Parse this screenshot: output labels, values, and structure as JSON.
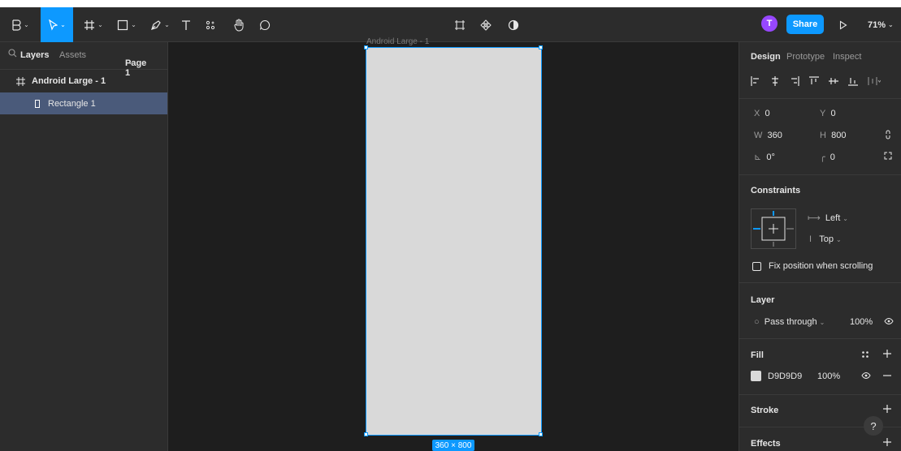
{
  "toolbar": {
    "zoom": "71%",
    "avatar_initial": "T",
    "share_label": "Share"
  },
  "left_panel": {
    "tab_layers": "Layers",
    "tab_assets": "Assets",
    "page": "Page 1",
    "layers": [
      {
        "name": "Android Large - 1",
        "type": "frame"
      },
      {
        "name": "Rectangle 1",
        "type": "rectangle",
        "selected": true
      }
    ]
  },
  "canvas": {
    "frame_label": "Android Large - 1",
    "size_badge": "360 × 800"
  },
  "right_panel": {
    "tabs": [
      "Design",
      "Prototype",
      "Inspect"
    ],
    "x_label": "X",
    "x": "0",
    "y_label": "Y",
    "y": "0",
    "w_label": "W",
    "w": "360",
    "h_label": "H",
    "h": "800",
    "rotation": "0°",
    "radius": "0",
    "constraints_title": "Constraints",
    "constraint_h": "Left",
    "constraint_v": "Top",
    "fix_position": "Fix position when scrolling",
    "layer_title": "Layer",
    "blend": "Pass through",
    "layer_opacity": "100%",
    "fill_title": "Fill",
    "fill_hex": "D9D9D9",
    "fill_color": "#d9d9d9",
    "fill_opacity": "100%",
    "stroke_title": "Stroke",
    "effects_title": "Effects"
  },
  "colors": {
    "accent": "#0d99ff",
    "avatar": "#9747ff",
    "selection_row": "#4a5a7a"
  }
}
